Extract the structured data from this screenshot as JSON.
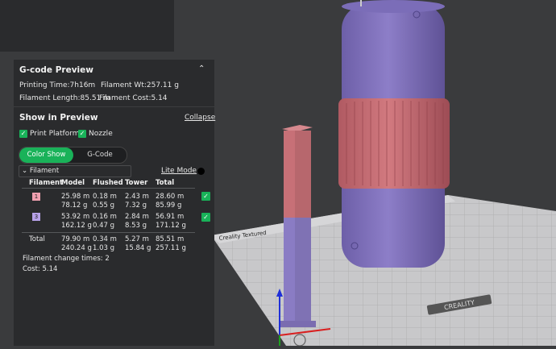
{
  "gcode_preview": {
    "title": "G-code Preview",
    "collapse_icon": "double-chevron-up-icon",
    "printing_time": "Printing Time:7h16m",
    "filament_wt": "Filament Wt:257.11 g",
    "filament_length": "Filament Length:85.51 m",
    "filament_cost": "Filament Cost:5.14"
  },
  "show_in_preview": {
    "title": "Show in Preview",
    "collapse_label": "Collapse",
    "print_platform_label": "Print Platform",
    "print_platform_checked": true,
    "nozzle_label": "Nozzle",
    "nozzle_checked": true
  },
  "modes": {
    "color_show": "Color Show",
    "gcode": "G-Code",
    "active": "Color Show"
  },
  "filament_select": {
    "value": "Filament"
  },
  "lite_mode": {
    "label": "Lite Mode"
  },
  "table": {
    "headers": [
      "Filament",
      "Model",
      "Flushed",
      "Tower",
      "Total"
    ],
    "rows": [
      {
        "id": "1",
        "color": "#f0a0b0",
        "model": [
          "25.98 m",
          "78.12 g"
        ],
        "flushed": [
          "0.18 m",
          "0.55 g"
        ],
        "tower": [
          "2.43 m",
          "7.32 g"
        ],
        "total": [
          "28.60 m",
          "85.99 g"
        ],
        "checked": true
      },
      {
        "id": "3",
        "color": "#b7a2e8",
        "model": [
          "53.92 m",
          "162.12 g"
        ],
        "flushed": [
          "0.16 m",
          "0.47 g"
        ],
        "tower": [
          "2.84 m",
          "8.53 g"
        ],
        "total": [
          "56.91 m",
          "171.12 g"
        ],
        "checked": true
      }
    ],
    "total": {
      "label": "Total",
      "model": [
        "79.90 m",
        "240.24 g"
      ],
      "flushed": [
        "0.34 m",
        "1.03 g"
      ],
      "tower": [
        "5.27 m",
        "15.84 g"
      ],
      "total": [
        "85.51 m",
        "257.11 g"
      ]
    }
  },
  "filament_change": "Filament change times:  2",
  "cost": "Cost:  5.14",
  "bed_text": {
    "left": "Creality Textured",
    "right": "CREALITY"
  }
}
